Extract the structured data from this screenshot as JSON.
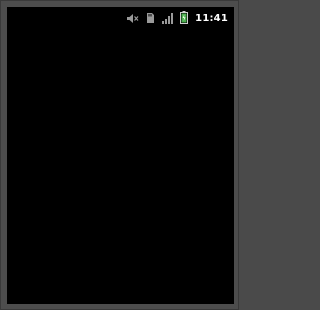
{
  "status_bar": {
    "time": "11:41",
    "icons": [
      "mute-icon",
      "sd-card-icon",
      "signal-icon",
      "battery-icon"
    ],
    "battery_color": "#4caf50"
  },
  "screen": {
    "background": "#000000"
  }
}
